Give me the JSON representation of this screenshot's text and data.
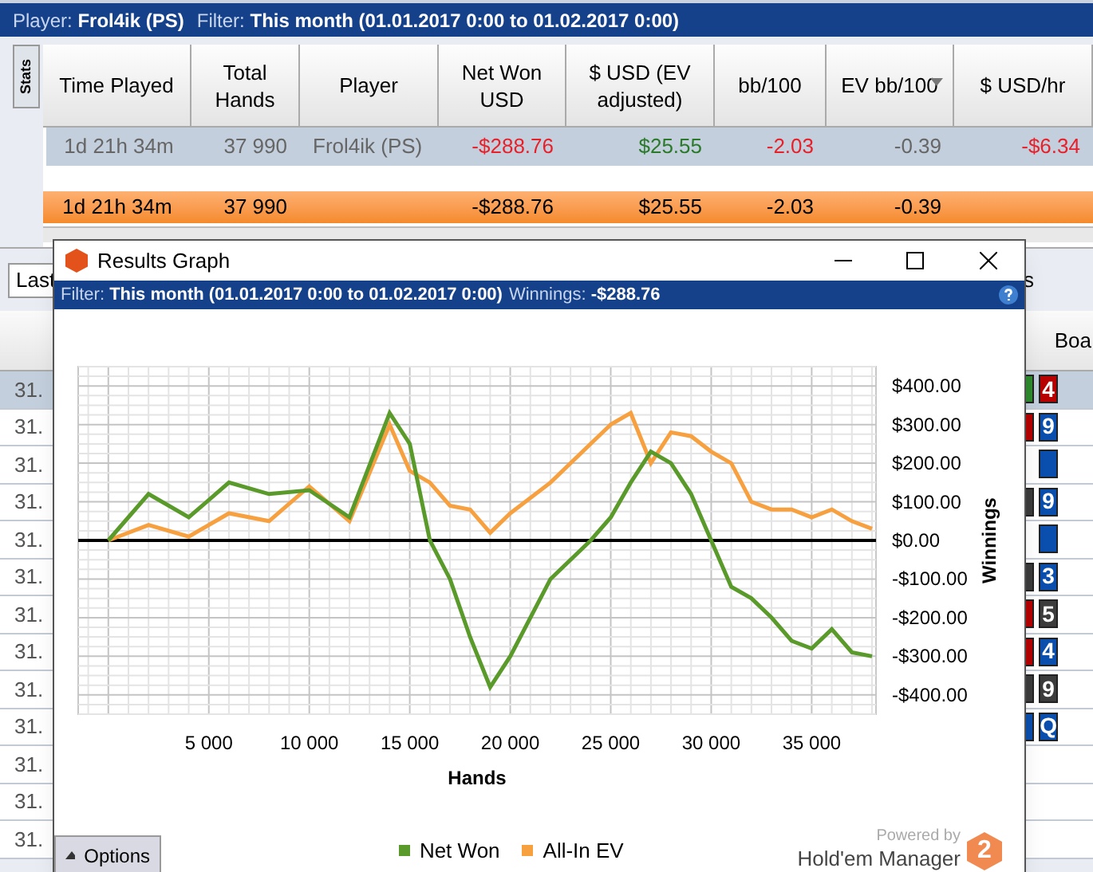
{
  "header": {
    "player_label": "Player:",
    "player": "Frol4ik (PS)",
    "filter_label": "Filter:",
    "filter": "This month (01.01.2017 0:00 to 01.02.2017 0:00)"
  },
  "side_tab": "Stats",
  "stats_table": {
    "columns": [
      {
        "label": "Time Played",
        "sort": false
      },
      {
        "label": "Total Hands",
        "sort": false
      },
      {
        "label": "Player",
        "sort": false
      },
      {
        "label": "Net Won USD",
        "sort": false
      },
      {
        "label": "$ USD (EV adjusted)",
        "sort": false
      },
      {
        "label": "bb/100",
        "sort": false
      },
      {
        "label": "EV bb/100",
        "sort": true
      },
      {
        "label": "$ USD/hr",
        "sort": false
      }
    ],
    "rows": [
      {
        "kind": "player",
        "cells": [
          {
            "text": "1d 21h 34m",
            "color": "#666666"
          },
          {
            "text": "37 990",
            "color": "#666666"
          },
          {
            "text": "Frol4ik (PS)",
            "color": "#666666"
          },
          {
            "text": "-$288.76",
            "color": "#e8202a"
          },
          {
            "text": "$25.55",
            "color": "#2a7a2a"
          },
          {
            "text": "-2.03",
            "color": "#e8202a"
          },
          {
            "text": "-0.39",
            "color": "#666666"
          },
          {
            "text": "-$6.34",
            "color": "#e8202a"
          }
        ]
      },
      {
        "kind": "total",
        "cells": [
          {
            "text": "1d 21h 34m"
          },
          {
            "text": "37 990"
          },
          {},
          {
            "text": "-$288.76"
          },
          {
            "text": "$25.55"
          },
          {
            "text": "-2.03"
          },
          {
            "text": "-0.39"
          },
          {}
        ]
      }
    ]
  },
  "toolbar": {
    "dropdown": "Last",
    "right_text": "s"
  },
  "hands_table": {
    "column_board": "Boa",
    "rows": [
      {
        "date": "31.",
        "selected": true,
        "cards": [
          {
            "color": "#2e8b2e"
          },
          {
            "color": "#b80000",
            "rank": "4"
          }
        ]
      },
      {
        "date": "31.",
        "selected": false,
        "cards": [
          {
            "color": "#b80000"
          },
          {
            "color": "#0a4fae",
            "rank": "9"
          }
        ]
      },
      {
        "date": "31.",
        "selected": false,
        "cards": [
          {
            "color": "#0a4fae"
          }
        ]
      },
      {
        "date": "31.",
        "selected": false,
        "cards": [
          {
            "color": "#3c3c3c"
          },
          {
            "color": "#0a4fae",
            "rank": "9"
          }
        ]
      },
      {
        "date": "31.",
        "selected": false,
        "cards": [
          {
            "color": "#0a4fae"
          }
        ]
      },
      {
        "date": "31.",
        "selected": false,
        "cards": [
          {
            "color": "#3c3c3c"
          },
          {
            "color": "#0a4fae",
            "rank": "3"
          }
        ]
      },
      {
        "date": "31.",
        "selected": false,
        "cards": [
          {
            "color": "#b80000"
          },
          {
            "color": "#3c3c3c",
            "rank": "5"
          }
        ]
      },
      {
        "date": "31.",
        "selected": false,
        "cards": [
          {
            "color": "#b80000"
          },
          {
            "color": "#0a4fae",
            "rank": "4"
          }
        ]
      },
      {
        "date": "31.",
        "selected": false,
        "cards": [
          {
            "color": "#3c3c3c"
          },
          {
            "color": "#3c3c3c",
            "rank": "9"
          }
        ]
      },
      {
        "date": "31.",
        "selected": false,
        "cards": [
          {
            "color": "#0a4fae"
          },
          {
            "color": "#0a4fae",
            "rank": "Q"
          }
        ]
      },
      {
        "date": "31.",
        "selected": false,
        "cards": []
      },
      {
        "date": "31.",
        "selected": false,
        "cards": []
      },
      {
        "date": "31.",
        "selected": false,
        "cards": []
      }
    ]
  },
  "graph_window": {
    "title": "Results Graph",
    "filter_label": "Filter:",
    "filter": "This month (01.01.2017 0:00 to 01.02.2017 0:00)",
    "winnings_label": "Winnings:",
    "winnings": "-$288.76",
    "chart_data": {
      "type": "line",
      "xlabel": "Hands",
      "ylabel": "Winnings",
      "x": [
        0,
        2000,
        4000,
        6000,
        8000,
        10000,
        12000,
        14000,
        15000,
        16000,
        17000,
        18000,
        19000,
        20000,
        22000,
        24000,
        25000,
        26000,
        27000,
        28000,
        29000,
        30000,
        31000,
        32000,
        33000,
        34000,
        35000,
        36000,
        37000,
        38000
      ],
      "series": [
        {
          "name": "Net Won",
          "color": "#5a9a2a",
          "values": [
            0,
            120,
            60,
            150,
            120,
            130,
            60,
            330,
            250,
            0,
            -100,
            -250,
            -380,
            -300,
            -100,
            0,
            60,
            150,
            230,
            200,
            120,
            0,
            -120,
            -150,
            -200,
            -260,
            -280,
            -230,
            -290,
            -300
          ]
        },
        {
          "name": "All-In EV",
          "color": "#f7a040",
          "values": [
            0,
            40,
            10,
            70,
            50,
            140,
            50,
            300,
            180,
            150,
            90,
            80,
            20,
            70,
            150,
            250,
            300,
            330,
            200,
            280,
            270,
            230,
            200,
            100,
            80,
            80,
            60,
            80,
            50,
            30
          ]
        }
      ],
      "grid": true,
      "xlim": [
        -1500,
        38200
      ],
      "ylim": [
        -450,
        450
      ],
      "xticks": [
        {
          "value": 5000,
          "label": "5 000"
        },
        {
          "value": 10000,
          "label": "10 000"
        },
        {
          "value": 15000,
          "label": "15 000"
        },
        {
          "value": 20000,
          "label": "20 000"
        },
        {
          "value": 25000,
          "label": "25 000"
        },
        {
          "value": 30000,
          "label": "30 000"
        },
        {
          "value": 35000,
          "label": "35 000"
        }
      ],
      "yticks": [
        {
          "value": 400,
          "label": "$400.00"
        },
        {
          "value": 300,
          "label": "$300.00"
        },
        {
          "value": 200,
          "label": "$200.00"
        },
        {
          "value": 100,
          "label": "$100.00"
        },
        {
          "value": 0,
          "label": "$0.00"
        },
        {
          "value": -100,
          "label": "-$100.00"
        },
        {
          "value": -200,
          "label": "-$200.00"
        },
        {
          "value": -300,
          "label": "-$300.00"
        },
        {
          "value": -400,
          "label": "-$400.00"
        }
      ]
    },
    "options_button": "Options",
    "powered_by": "Powered by",
    "brand": "Hold'em Manager",
    "brand_logo": "2"
  }
}
